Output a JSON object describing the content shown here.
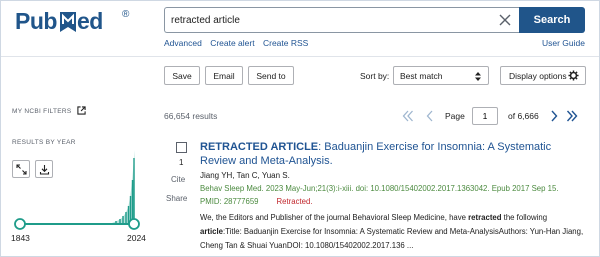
{
  "brand": {
    "logo_text_left": "Pub",
    "logo_text_right": "ed",
    "registered": "®",
    "color": "#20558a"
  },
  "search": {
    "value": "retracted article",
    "button_label": "Search"
  },
  "links": {
    "advanced": "Advanced",
    "create_alert": "Create alert",
    "create_rss": "Create RSS",
    "user_guide": "User Guide"
  },
  "toolbar": {
    "save": "Save",
    "email": "Email",
    "send_to": "Send to",
    "sort_by_label": "Sort by:",
    "sort_value": "Best match",
    "display_options": "Display options"
  },
  "sidebar": {
    "filters_label": "MY NCBI FILTERS",
    "results_by_year_label": "RESULTS BY YEAR",
    "year_start": "1843",
    "year_end": "2024",
    "expand_icon": "expand-icon",
    "download_icon": "download-icon"
  },
  "results": {
    "count_text": "66,654 results",
    "page_label": "Page",
    "page_value": "1",
    "of_pages": "of 6,666"
  },
  "article": {
    "rank": "1",
    "cite": "Cite",
    "share": "Share",
    "title_strong": "RETRACTED ARTICLE",
    "title_rest": ": Baduanjin Exercise for Insomnia: A Systematic Review and Meta-Analysis.",
    "authors": "Jiang YH, Tan C, Yuan S.",
    "journal": "Behav Sleep Med. 2023 May-Jun;21(3):i-xiii. doi: 10.1080/15402002.2017.1363042. Epub 2017 Sep 15.",
    "pmid": "PMID: 28777659",
    "retracted": "Retracted.",
    "snippet_1": "We, the Editors and Publisher of the journal Behavioral Sleep Medicine, have ",
    "snippet_bold_1": "retracted",
    "snippet_2": " the following ",
    "snippet_bold_2": "article",
    "snippet_3": ":Title: Baduanjin Exercise for Insomnia: A Systematic Review and Meta-AnalysisAuthors: Yun-Han Jiang, Cheng Tan & Shuai YuanDOI: 10.1080/15402002.2017.136 ..."
  },
  "colors": {
    "link": "#205493",
    "journal_green": "#4b8a3f",
    "retracted_red": "#c1272d",
    "histogram_teal": "#1f9c8a"
  }
}
